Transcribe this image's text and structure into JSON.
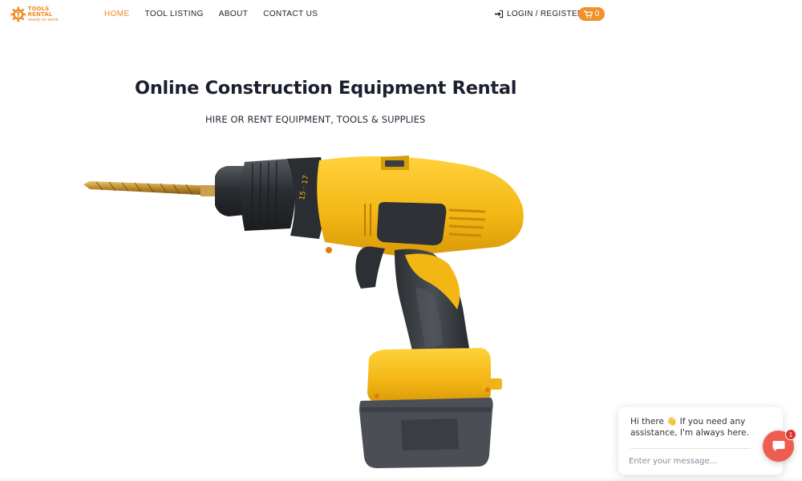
{
  "brand": {
    "name": "TOOLS RENTAL",
    "tagline": "ready-to-work",
    "color": "#f08a24"
  },
  "nav": {
    "items": [
      {
        "label": "HOME",
        "active": true
      },
      {
        "label": "TOOL LISTING",
        "active": false
      },
      {
        "label": "ABOUT",
        "active": false
      },
      {
        "label": "CONTACT US",
        "active": false
      }
    ],
    "login_label": "LOGIN / REGISTER",
    "login_icon": "sign-in-icon",
    "cart_icon": "shopping-cart-icon",
    "cart_count": "0",
    "cart_color": "#f0912c"
  },
  "hero": {
    "title": "Online Construction Equipment Rental",
    "subtitle": "HIRE OR RENT EQUIPMENT, TOOLS & SUPPLIES",
    "image": "cordless-drill-image"
  },
  "chat": {
    "greeting": "Hi there 👋 If you need any assistance, I'm always here.",
    "input_placeholder": "Enter your message...",
    "button_icon": "chat-bubble-icon",
    "badge_count": "1",
    "button_color": "#ef5d50"
  }
}
